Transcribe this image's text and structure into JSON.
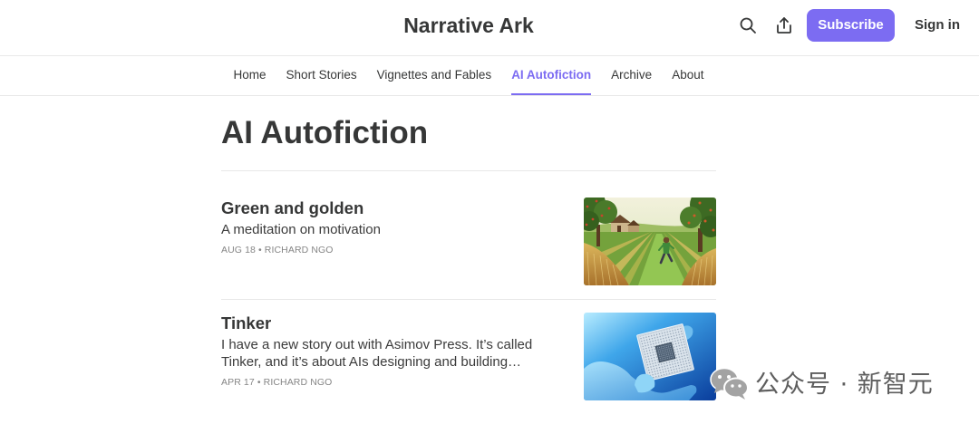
{
  "site": {
    "title": "Narrative Ark"
  },
  "header": {
    "search_icon": "search-icon",
    "share_icon": "share-icon",
    "subscribe_label": "Subscribe",
    "signin_label": "Sign in"
  },
  "nav": {
    "items": [
      {
        "label": "Home",
        "active": false
      },
      {
        "label": "Short Stories",
        "active": false
      },
      {
        "label": "Vignettes and Fables",
        "active": false
      },
      {
        "label": "AI Autofiction",
        "active": true
      },
      {
        "label": "Archive",
        "active": false
      },
      {
        "label": "About",
        "active": false
      }
    ]
  },
  "page": {
    "title": "AI Autofiction"
  },
  "meta_separator": "•",
  "posts": [
    {
      "title": "Green and golden",
      "subtitle": "A meditation on motivation",
      "date": "AUG 18",
      "author": "RICHARD NGO"
    },
    {
      "title": "Tinker",
      "subtitle": "I have a new story out with Asimov Press. It’s called Tinker, and it’s about AIs designing and building…",
      "date": "APR 17",
      "author": "RICHARD NGO"
    }
  ],
  "watermark": {
    "icon": "wechat-icon",
    "text": "公众号 · 新智元"
  },
  "colors": {
    "accent": "#7c6cf2",
    "text": "#363737",
    "meta": "#868686",
    "border": "#e8e8e8",
    "background": "#ffffff"
  }
}
